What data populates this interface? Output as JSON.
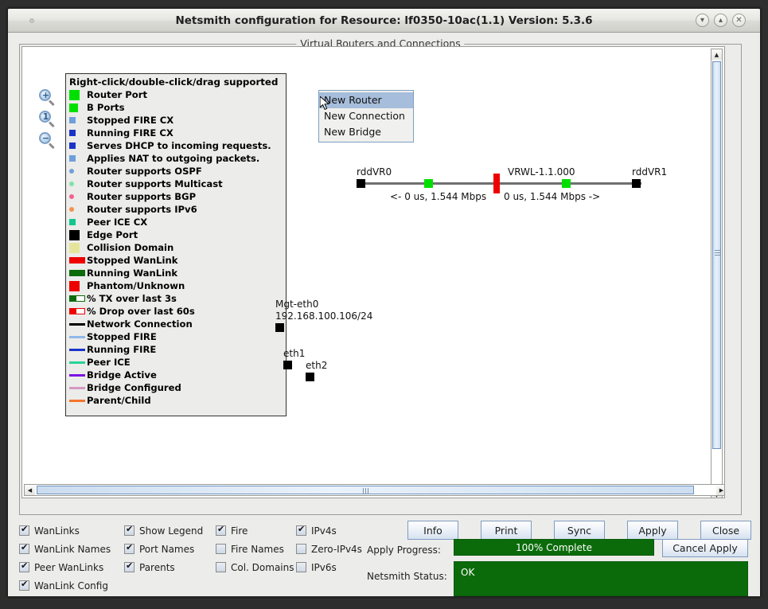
{
  "window": {
    "title": "Netsmith configuration for Resource:  lf0350-10ac(1.1)  Version: 5.3.6",
    "minimize_icon": "chevron-down-icon",
    "maximize_icon": "chevron-up-icon",
    "close_icon": "close-icon"
  },
  "panel": {
    "label": "Virtual Routers and Connections"
  },
  "zoom_tools": [
    {
      "name": "zoom-in",
      "symbol": "+"
    },
    {
      "name": "zoom-reset",
      "symbol": "1"
    },
    {
      "name": "zoom-out",
      "symbol": "−"
    }
  ],
  "legend": {
    "header": "Right-click/double-click/drag supported",
    "items": [
      {
        "label": "Router Port",
        "kind": "square",
        "size": "lg",
        "color": "#00e000"
      },
      {
        "label": "B Ports",
        "kind": "square",
        "size": "md",
        "color": "#00e000"
      },
      {
        "label": "Stopped FIRE CX",
        "kind": "square",
        "size": "sm",
        "color": "#6f9fdb"
      },
      {
        "label": "Running FIRE CX",
        "kind": "square",
        "size": "sm",
        "color": "#1b34c8"
      },
      {
        "label": "Serves DHCP to incoming requests.",
        "kind": "square",
        "size": "sm",
        "color": "#1b34c8"
      },
      {
        "label": "Applies NAT to outgoing packets.",
        "kind": "square",
        "size": "sm",
        "color": "#6f9fdb"
      },
      {
        "label": "Router supports OSPF",
        "kind": "dot",
        "size": "xs",
        "color": "#6f9fdb"
      },
      {
        "label": "Router supports Multicast",
        "kind": "dot",
        "size": "xs",
        "color": "#81e3a6"
      },
      {
        "label": "Router supports BGP",
        "kind": "dot",
        "size": "xs",
        "color": "#f4628f"
      },
      {
        "label": "Router supports IPv6",
        "kind": "dot",
        "size": "xs",
        "color": "#f4924e"
      },
      {
        "label": "Peer ICE CX",
        "kind": "square",
        "size": "sm",
        "color": "#12c78e"
      },
      {
        "label": "Edge Port",
        "kind": "square",
        "size": "lg",
        "color": "#000000"
      },
      {
        "label": "Collision Domain",
        "kind": "square",
        "size": "lg",
        "color": "#e5e59a"
      },
      {
        "label": "Stopped WanLink",
        "kind": "bar",
        "color": "#ee0000"
      },
      {
        "label": "Running WanLink",
        "kind": "bar",
        "color": "#0a6b0a"
      },
      {
        "label": "Phantom/Unknown",
        "kind": "square",
        "size": "lg",
        "color": "#ee0000"
      },
      {
        "label": "% TX over last 3s",
        "kind": "meter",
        "color": "#0a6b0a",
        "fill_pct": 45
      },
      {
        "label": "% Drop over last 60s",
        "kind": "meter",
        "color": "#ee0000",
        "fill_pct": 45
      },
      {
        "label": "Network Connection",
        "kind": "line",
        "color": "#000000"
      },
      {
        "label": "Stopped FIRE",
        "kind": "line",
        "color": "#90b8e8"
      },
      {
        "label": "Running FIRE",
        "kind": "line",
        "color": "#1b34c8"
      },
      {
        "label": "Peer ICE",
        "kind": "line",
        "color": "#27d39b"
      },
      {
        "label": "Bridge Active",
        "kind": "line",
        "color": "#7d12e0"
      },
      {
        "label": "Bridge Configured",
        "kind": "line",
        "color": "#d49ac4"
      },
      {
        "label": "Parent/Child",
        "kind": "line",
        "color": "#f4772b"
      }
    ]
  },
  "context_menu": {
    "items": [
      {
        "label": "New Router",
        "selected": true
      },
      {
        "label": "New Connection",
        "selected": false
      },
      {
        "label": "New Bridge",
        "selected": false
      }
    ]
  },
  "diagram": {
    "nodes": [
      {
        "name": "router-rddvr0",
        "label": "rddVR0"
      },
      {
        "name": "router-rddvr1",
        "label": "rddVR1"
      },
      {
        "name": "wanlink-vrwl",
        "label": "VRWL-1.1.000"
      },
      {
        "name": "port-mgt-eth0",
        "label": "Mgt-eth0"
      },
      {
        "name": "port-mgt-eth0-ip",
        "label": "192.168.100.106/24"
      },
      {
        "name": "port-eth1",
        "label": "eth1"
      },
      {
        "name": "port-eth2",
        "label": "eth2"
      }
    ],
    "rate_left": "<- 0 us, 1.544 Mbps",
    "rate_right": "0 us, 1.544 Mbps ->"
  },
  "checkboxes": [
    {
      "label": "WanLinks",
      "checked": true,
      "col": 0,
      "row": 0
    },
    {
      "label": "WanLink Names",
      "checked": true,
      "col": 0,
      "row": 1
    },
    {
      "label": "Peer WanLinks",
      "checked": true,
      "col": 0,
      "row": 2
    },
    {
      "label": "WanLink Config",
      "checked": true,
      "col": 0,
      "row": 3
    },
    {
      "label": "Show Legend",
      "checked": true,
      "col": 1,
      "row": 0
    },
    {
      "label": "Port Names",
      "checked": true,
      "col": 1,
      "row": 1
    },
    {
      "label": "Parents",
      "checked": true,
      "col": 1,
      "row": 2
    },
    {
      "label": "Fire",
      "checked": true,
      "col": 2,
      "row": 0
    },
    {
      "label": "Fire Names",
      "checked": false,
      "col": 2,
      "row": 1
    },
    {
      "label": "Col. Domains",
      "checked": false,
      "col": 2,
      "row": 2
    },
    {
      "label": "IPv4s",
      "checked": true,
      "col": 3,
      "row": 0
    },
    {
      "label": "Zero-IPv4s",
      "checked": false,
      "col": 3,
      "row": 1
    },
    {
      "label": "IPv6s",
      "checked": false,
      "col": 3,
      "row": 2
    }
  ],
  "buttons": [
    {
      "name": "info-button",
      "label": "Info"
    },
    {
      "name": "print-button",
      "label": "Print"
    },
    {
      "name": "sync-button",
      "label": "Sync"
    },
    {
      "name": "apply-button",
      "label": "Apply"
    },
    {
      "name": "close-button",
      "label": "Close"
    }
  ],
  "cancel_apply": {
    "label": "Cancel Apply"
  },
  "progress": {
    "label": "Apply Progress:",
    "value": "100% Complete",
    "percent": 100,
    "color": "#0b6b0b"
  },
  "status": {
    "label": "Netsmith Status:",
    "value": "OK",
    "color": "#0b6b0b"
  }
}
